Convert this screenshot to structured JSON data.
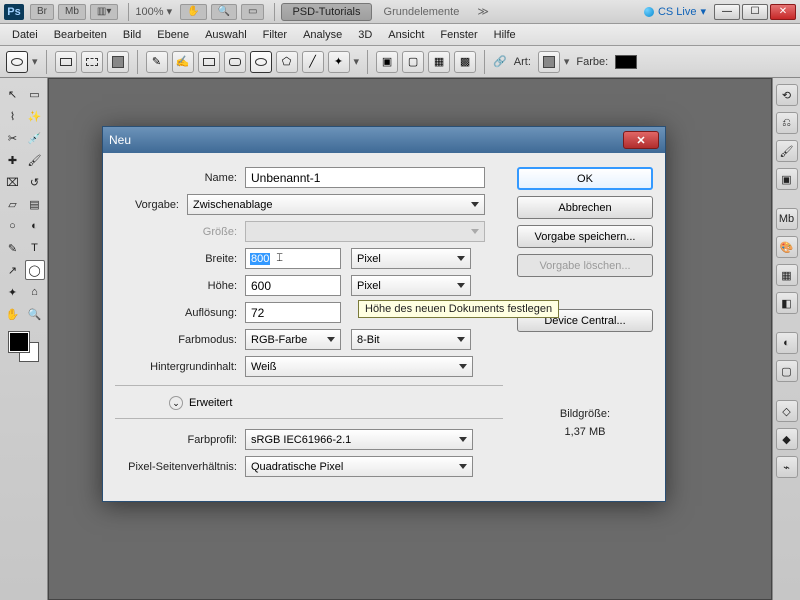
{
  "appbar": {
    "br": "Br",
    "mb": "Mb",
    "zoom": "100%",
    "tab_active": "PSD-Tutorials",
    "tab_inactive": "Grundelemente",
    "cs_live": "CS Live"
  },
  "menu": {
    "items": [
      "Datei",
      "Bearbeiten",
      "Bild",
      "Ebene",
      "Auswahl",
      "Filter",
      "Analyse",
      "3D",
      "Ansicht",
      "Fenster",
      "Hilfe"
    ]
  },
  "optbar": {
    "art": "Art:",
    "farbe": "Farbe:"
  },
  "dialog": {
    "title": "Neu",
    "labels": {
      "name": "Name:",
      "vorgabe": "Vorgabe:",
      "groesse": "Größe:",
      "breite": "Breite:",
      "hoehe": "Höhe:",
      "aufloesung": "Auflösung:",
      "farbmodus": "Farbmodus:",
      "hintergrund": "Hintergrundinhalt:",
      "erweitert": "Erweitert",
      "farbprofil": "Farbprofil:",
      "pixelsv": "Pixel-Seitenverhältnis:"
    },
    "values": {
      "name": "Unbenannt-1",
      "vorgabe": "Zwischenablage",
      "breite": "800",
      "hoehe": "600",
      "breite_unit": "Pixel",
      "hoehe_unit": "Pixel",
      "aufloesung": "72",
      "farbmodus": "RGB-Farbe",
      "bit": "8-Bit",
      "hintergrund": "Weiß",
      "farbprofil": "sRGB IEC61966-2.1",
      "pixelsv": "Quadratische Pixel"
    },
    "buttons": {
      "ok": "OK",
      "cancel": "Abbrechen",
      "save_preset": "Vorgabe speichern...",
      "del_preset": "Vorgabe löschen...",
      "device_central": "Device Central..."
    },
    "size_label": "Bildgröße:",
    "size_value": "1,37 MB",
    "tooltip": "Höhe des neuen Dokuments festlegen"
  }
}
